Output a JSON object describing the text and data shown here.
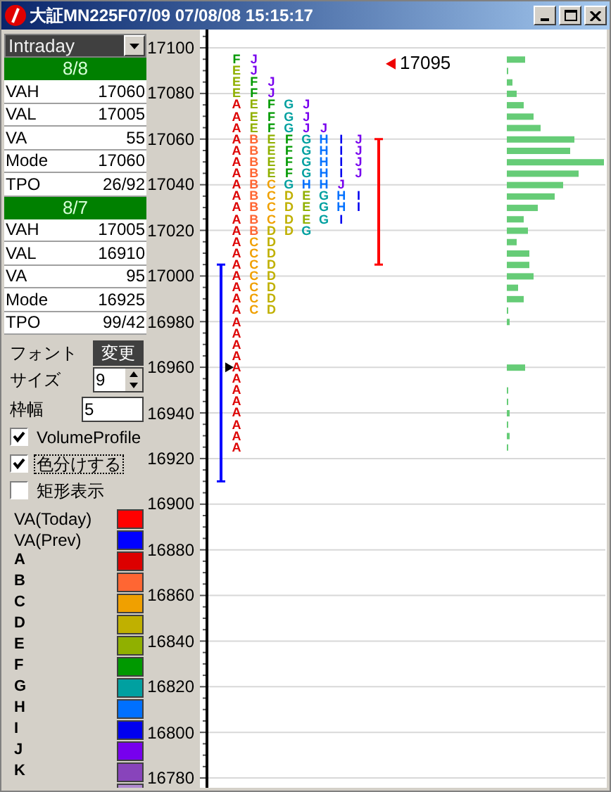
{
  "window": {
    "title": "大証MN225F07/09 07/08/08 15:15:17"
  },
  "mode_dropdown": {
    "value": "Intraday"
  },
  "sessions": [
    {
      "date": "8/8",
      "rows": [
        {
          "label": "VAH",
          "value": "17060"
        },
        {
          "label": "VAL",
          "value": "17005"
        },
        {
          "label": "VA",
          "value": "55"
        },
        {
          "label": "Mode",
          "value": "17060"
        },
        {
          "label": "TPO",
          "value": "26/92"
        }
      ]
    },
    {
      "date": "8/7",
      "rows": [
        {
          "label": "VAH",
          "value": "17005"
        },
        {
          "label": "VAL",
          "value": "16910"
        },
        {
          "label": "VA",
          "value": "95"
        },
        {
          "label": "Mode",
          "value": "16925"
        },
        {
          "label": "TPO",
          "value": "99/42"
        }
      ]
    }
  ],
  "font": {
    "label": "フォント",
    "button": "変更"
  },
  "size": {
    "label": "サイズ",
    "value": "9"
  },
  "frame_width": {
    "label": "枠幅",
    "value": "5"
  },
  "options": [
    {
      "label": "VolumeProfile",
      "checked": true,
      "focused": false
    },
    {
      "label": "色分けする",
      "checked": true,
      "focused": true
    },
    {
      "label": "矩形表示",
      "checked": false,
      "focused": false
    }
  ],
  "legend": [
    {
      "label": "VA(Today)",
      "color": "#ff0000"
    },
    {
      "label": "VA(Prev)",
      "color": "#0000ff"
    },
    {
      "label": "A",
      "color": "#dd0000"
    },
    {
      "label": "B",
      "color": "#ff6633"
    },
    {
      "label": "C",
      "color": "#f0a000"
    },
    {
      "label": "D",
      "color": "#c0b000"
    },
    {
      "label": "E",
      "color": "#90b000"
    },
    {
      "label": "F",
      "color": "#009900"
    },
    {
      "label": "G",
      "color": "#00a0a0"
    },
    {
      "label": "H",
      "color": "#0070ff"
    },
    {
      "label": "I",
      "color": "#0000f0"
    },
    {
      "label": "J",
      "color": "#7700ee"
    },
    {
      "label": "K",
      "color": "#8844bb"
    },
    {
      "color": "#b08ad0"
    }
  ],
  "price_axis": [
    "17100",
    "17080",
    "17060",
    "17040",
    "17020",
    "17000",
    "16980",
    "16960",
    "16940",
    "16920",
    "16900",
    "16880",
    "16860",
    "16840",
    "16820",
    "16800",
    "16780"
  ],
  "last_price": "17095",
  "tpo_columns": [
    "FEEEAAAAAAAAAAAAAAAAAAAAAAAAAAAAAAA",
    "JJFFEEEBBBBBBBBBCCCCCCC",
    "  JJFFFEEEECCCCDDDDDDDD",
    "    GGGFFFFGDDDD",
    "    JJJGGGGHEEEG",
    "      JHHHHHGGG",
    "       IIIIJHHI",
    "       JJJJ II"
  ]
}
